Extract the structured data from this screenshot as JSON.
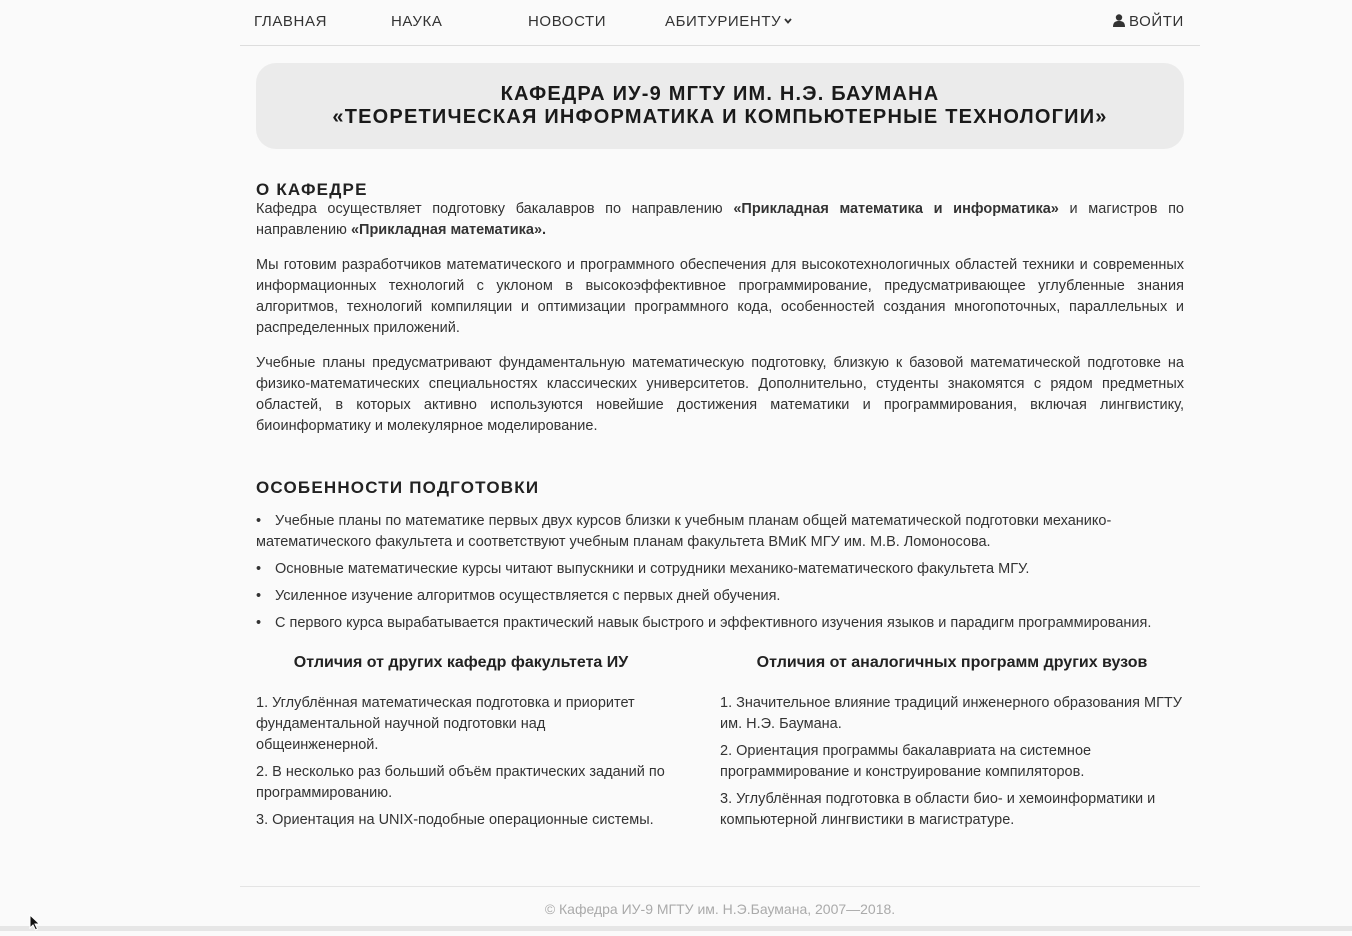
{
  "nav": {
    "home": "ГЛАВНАЯ",
    "science": "НАУКА",
    "news": "НОВОСТИ",
    "applicant": "АБИТУРИЕНТУ",
    "login": "ВОЙТИ"
  },
  "hero": {
    "line1": "КАФЕДРА ИУ-9 МГТУ ИМ. Н.Э. БАУМАНА",
    "line2": "«ТЕОРЕТИЧЕСКАЯ ИНФОРМАТИКА И КОМПЬЮТЕРНЫЕ ТЕХНОЛОГИИ»"
  },
  "about": {
    "title": "О КАФЕДРЕ",
    "p1_a": "Кафедра осуществляет подготовку бакалавров по направлению ",
    "p1_b": "«Прикладная математика и информатика»",
    "p1_c": " и магистров по направлению ",
    "p1_d": "«Прикладная математика».",
    "p2": "Мы готовим разработчиков математического и программного обеспечения для высокотехнологичных областей техники и современных информационных технологий с уклоном в высокоэффективное программирование, предусматривающее углубленные знания алгоритмов, технологий компиляции и оптимизации программного кода, особенностей создания многопоточных, параллельных и распределенных приложений.",
    "p3": "Учебные планы предусматривают фундаментальную математическую подготовку, близкую к базовой математической подготовке на физико-математических специальностях классических университетов. Дополнительно, студенты знакомятся с рядом предметных областей, в которых активно используются новейшие достижения математики и программирования, включая лингвистику, биоинформатику и молекулярное моделирование."
  },
  "features": {
    "title": "ОСОБЕННОСТИ ПОДГОТОВКИ",
    "items": [
      "Учебные планы по математике первых двух курсов близки к учебным планам общей математической подготовки механико-математического факультета и соответствуют учебным планам факультета ВМиК МГУ им. М.В. Ломоносова.",
      "Основные математические курсы читают выпускники и сотрудники механико-математического факультета МГУ.",
      "Усиленное изучение алгоритмов осуществляется с первых дней обучения.",
      "С первого курса вырабатывается практический навык быстрого и эффективного изучения языков и парадигм программирования."
    ]
  },
  "diff_faculty": {
    "title": "Отличия от других кафедр факультета ИУ",
    "items": [
      "1. Углублённая математическая подготовка и приоритет фундаментальной научной подготовки над общеинженерной.",
      "2. В несколько раз больший объём практических заданий по программированию.",
      "3. Ориентация на UNIX-подобные операционные системы."
    ]
  },
  "diff_universities": {
    "title": "Отличия от аналогичных программ других вузов",
    "items": [
      "1. Значительное влияние традиций инженерного образования МГТУ им. Н.Э. Баумана.",
      "2. Ориентация программы бакалавриата на системное программирование и конструирование компиляторов.",
      "3. Углублённая подготовка в области био- и хемоинформатики и компьютерной лингвистики в магистратуре."
    ]
  },
  "footer": {
    "copyright": "© Кафедра ИУ-9 МГТУ им. Н.Э.Баумана, 2007—2018."
  },
  "icons": {
    "user": "user-icon",
    "caret": "chevron-down-icon",
    "cursor": "mouse-cursor-icon"
  }
}
